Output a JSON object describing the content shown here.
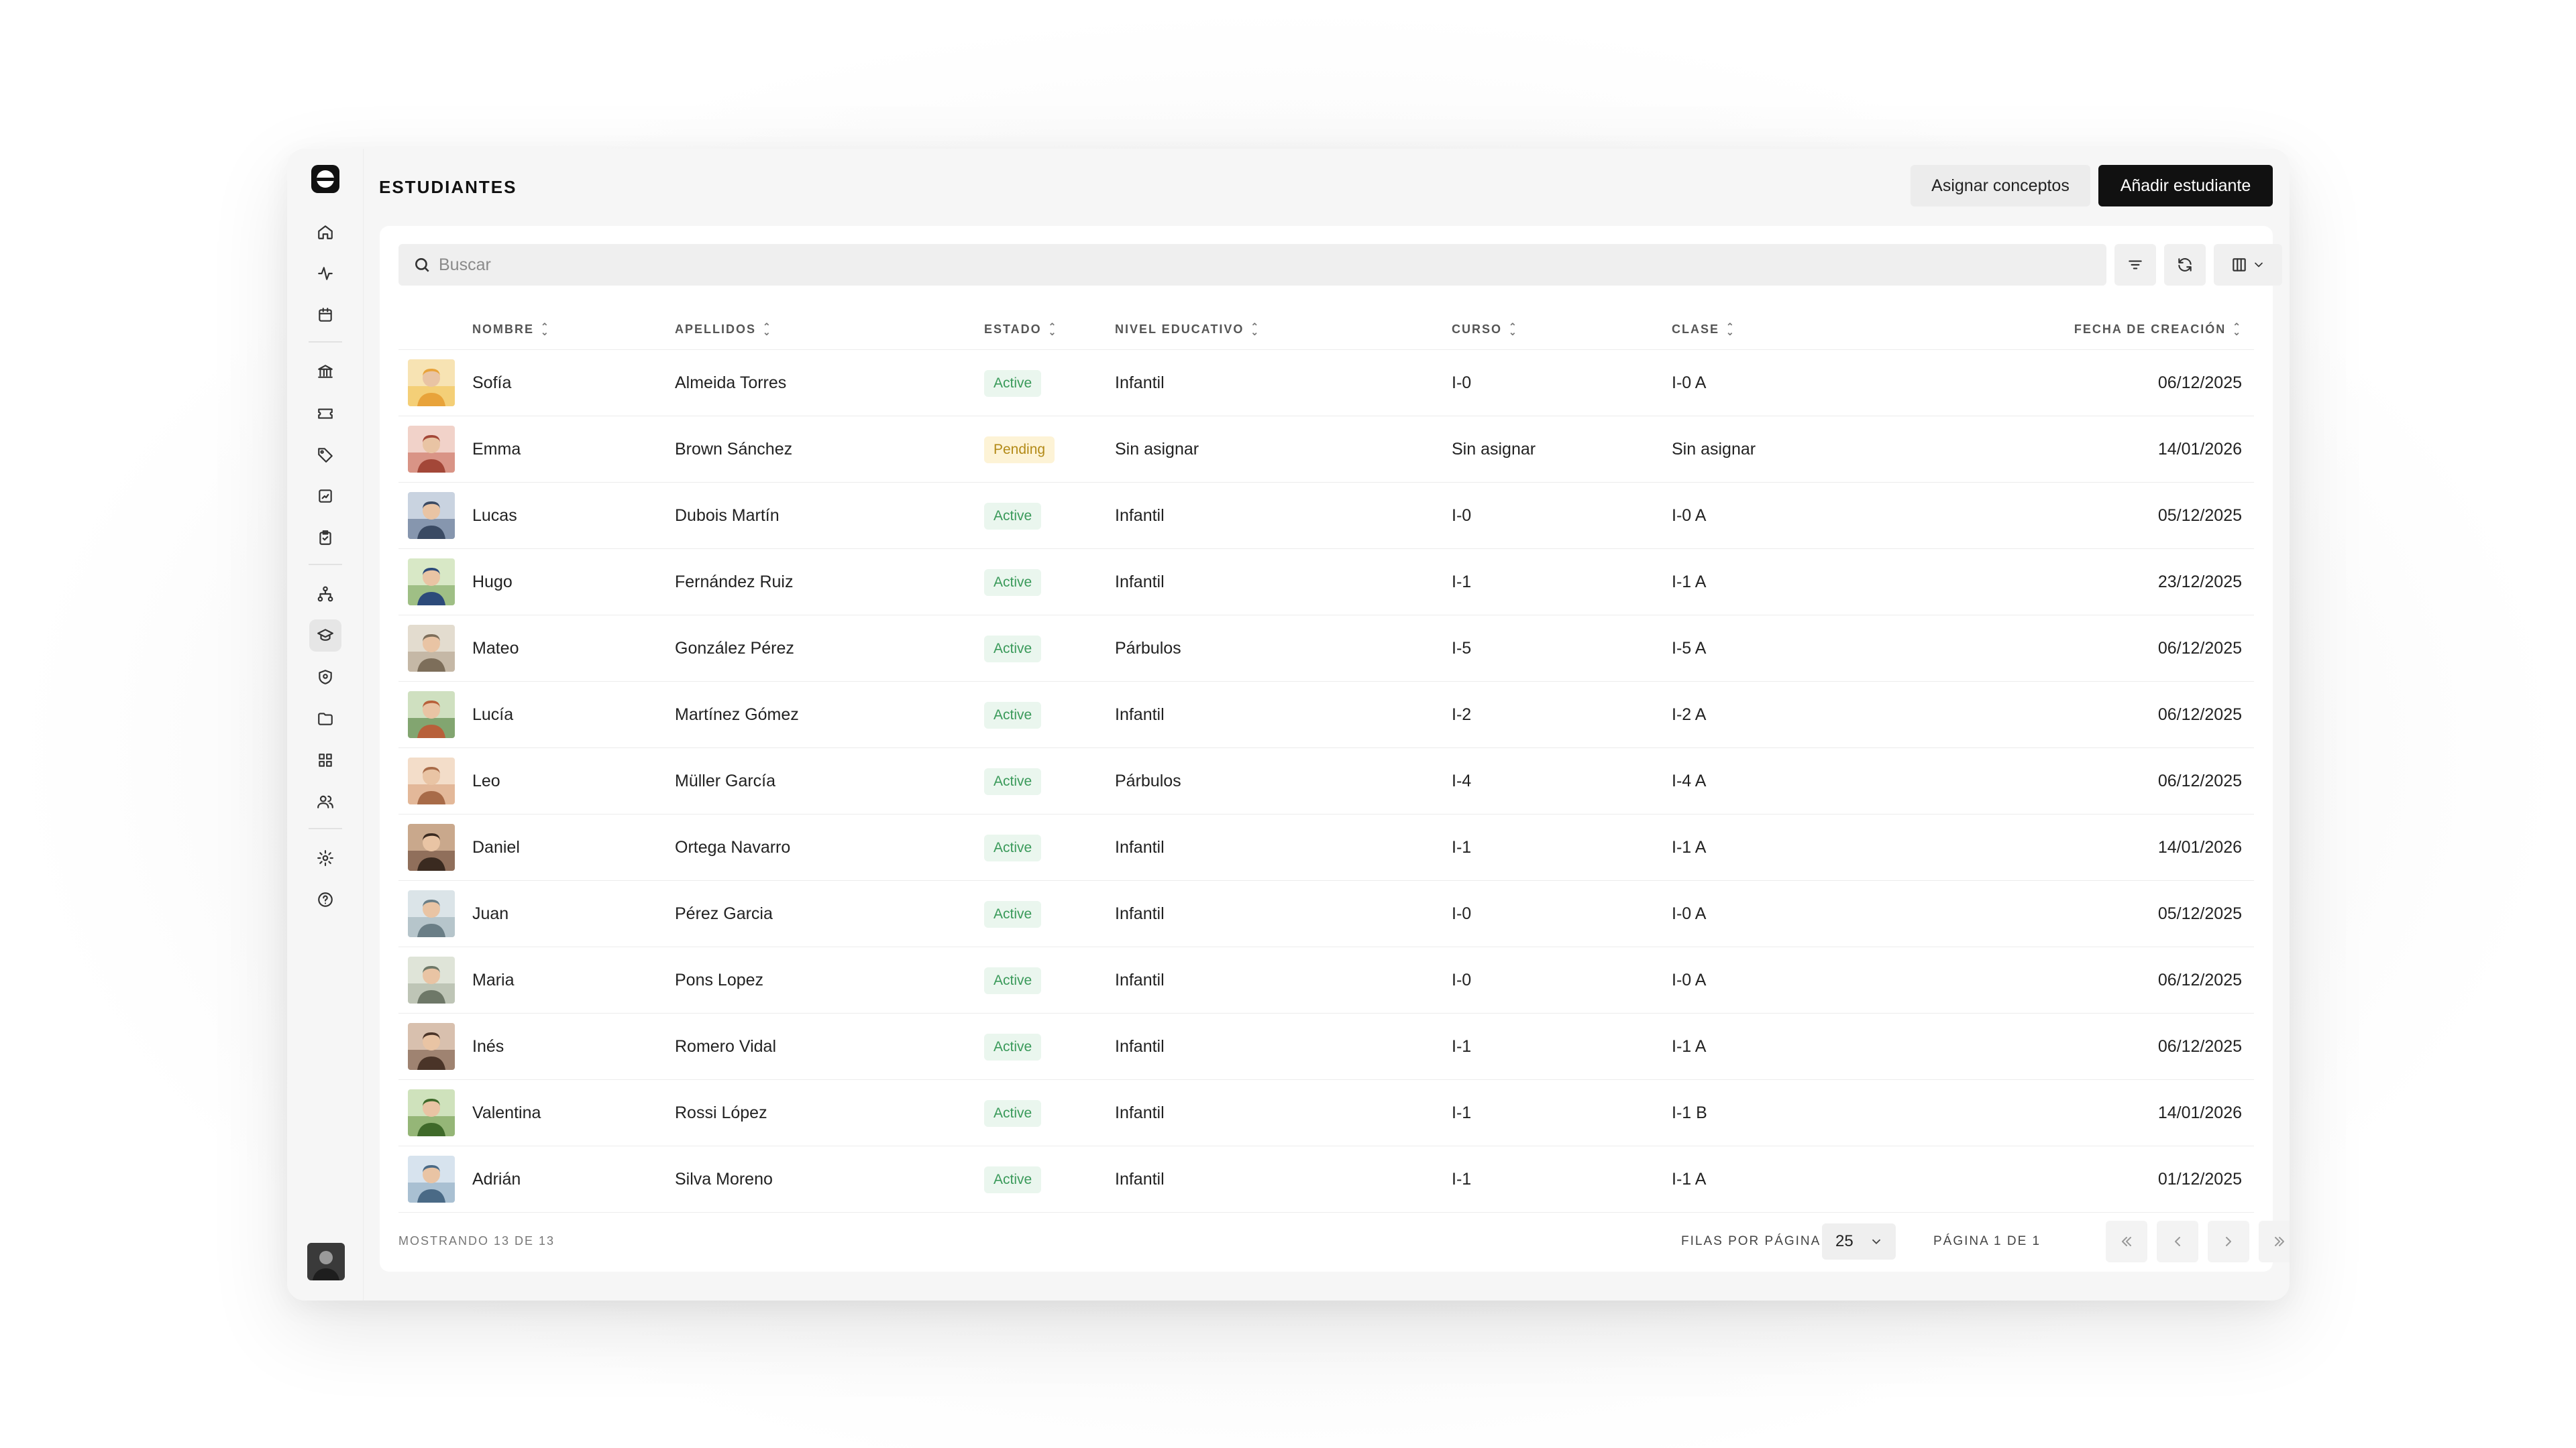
{
  "page": {
    "title": "ESTUDIANTES",
    "assign_concepts_label": "Asignar conceptos",
    "add_student_label": "Añadir estudiante"
  },
  "search": {
    "placeholder": "Buscar",
    "value": ""
  },
  "table": {
    "columns": [
      "NOMBRE",
      "APELLIDOS",
      "ESTADO",
      "NIVEL EDUCATIVO",
      "CURSO",
      "CLASE",
      "FECHA DE CREACIÓN"
    ],
    "rows": [
      {
        "nombre": "Sofía",
        "apellidos": "Almeida Torres",
        "estado": "Active",
        "nivel": "Infantil",
        "curso": "I-0",
        "clase": "I-0 A",
        "fecha": "06/12/2025"
      },
      {
        "nombre": "Emma",
        "apellidos": "Brown Sánchez",
        "estado": "Pending",
        "nivel": "Sin asignar",
        "curso": "Sin asignar",
        "clase": "Sin asignar",
        "fecha": "14/01/2026"
      },
      {
        "nombre": "Lucas",
        "apellidos": "Dubois Martín",
        "estado": "Active",
        "nivel": "Infantil",
        "curso": "I-0",
        "clase": "I-0 A",
        "fecha": "05/12/2025"
      },
      {
        "nombre": "Hugo",
        "apellidos": "Fernández Ruiz",
        "estado": "Active",
        "nivel": "Infantil",
        "curso": "I-1",
        "clase": "I-1 A",
        "fecha": "23/12/2025"
      },
      {
        "nombre": "Mateo",
        "apellidos": "González Pérez",
        "estado": "Active",
        "nivel": "Párbulos",
        "curso": "I-5",
        "clase": "I-5 A",
        "fecha": "06/12/2025"
      },
      {
        "nombre": "Lucía",
        "apellidos": "Martínez Gómez",
        "estado": "Active",
        "nivel": "Infantil",
        "curso": "I-2",
        "clase": "I-2 A",
        "fecha": "06/12/2025"
      },
      {
        "nombre": "Leo",
        "apellidos": "Müller García",
        "estado": "Active",
        "nivel": "Párbulos",
        "curso": "I-4",
        "clase": "I-4 A",
        "fecha": "06/12/2025"
      },
      {
        "nombre": "Daniel",
        "apellidos": "Ortega Navarro",
        "estado": "Active",
        "nivel": "Infantil",
        "curso": "I-1",
        "clase": "I-1 A",
        "fecha": "14/01/2026"
      },
      {
        "nombre": "Juan",
        "apellidos": "Pérez Garcia",
        "estado": "Active",
        "nivel": "Infantil",
        "curso": "I-0",
        "clase": "I-0 A",
        "fecha": "05/12/2025"
      },
      {
        "nombre": "Maria",
        "apellidos": "Pons Lopez",
        "estado": "Active",
        "nivel": "Infantil",
        "curso": "I-0",
        "clase": "I-0 A",
        "fecha": "06/12/2025"
      },
      {
        "nombre": "Inés",
        "apellidos": "Romero Vidal",
        "estado": "Active",
        "nivel": "Infantil",
        "curso": "I-1",
        "clase": "I-1 A",
        "fecha": "06/12/2025"
      },
      {
        "nombre": "Valentina",
        "apellidos": "Rossi López",
        "estado": "Active",
        "nivel": "Infantil",
        "curso": "I-1",
        "clase": "I-1 B",
        "fecha": "14/01/2026"
      },
      {
        "nombre": "Adrián",
        "apellidos": "Silva Moreno",
        "estado": "Active",
        "nivel": "Infantil",
        "curso": "I-1",
        "clase": "I-1 A",
        "fecha": "01/12/2025"
      }
    ]
  },
  "footer": {
    "showing": "MOSTRANDO 13 DE 13",
    "rows_per_page_label": "FILAS POR PÁGINA",
    "rows_per_page_value": "25",
    "page_label": "PÁGINA 1 DE 1"
  },
  "sidebar": {
    "icons": [
      "home-icon",
      "activity-icon",
      "calendar-icon",
      "bank-icon",
      "ticket-icon",
      "tag-icon",
      "checklist-icon",
      "clipboard-icon",
      "hierarchy-icon",
      "graduation-cap-icon",
      "shield-icon",
      "folder-icon",
      "grid-icon",
      "users-icon",
      "settings-icon",
      "help-icon"
    ]
  },
  "colors": {
    "accent": "#111111",
    "active_badge_bg": "#eaf6ee",
    "active_badge_text": "#3a9a5a",
    "pending_badge_bg": "#fdf3d6",
    "pending_badge_text": "#b38a17"
  }
}
